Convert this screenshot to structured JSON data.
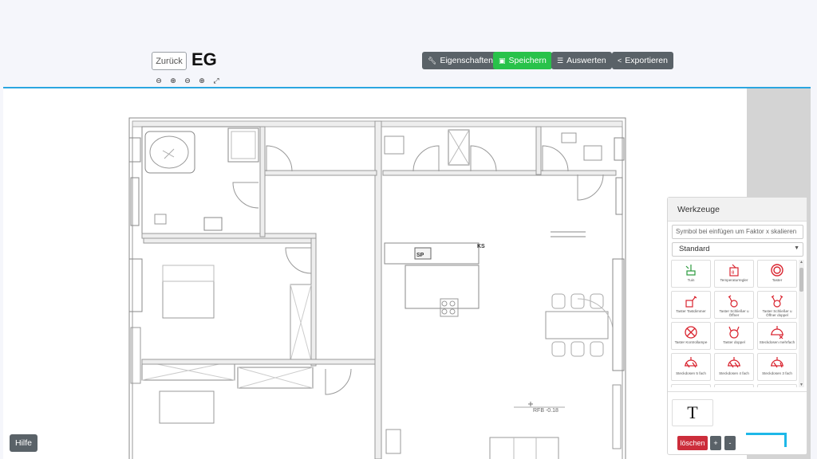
{
  "header": {
    "back_label": "Zurück",
    "title": "EG",
    "zoom_icons": [
      "zoom-out-icon",
      "zoom-in-icon",
      "zoom-reset-icon",
      "zoom-fit-icon",
      "fullscreen-icon"
    ]
  },
  "toolbar": {
    "properties_label": "Eigenschaften",
    "save_label": "Speichern",
    "evaluate_label": "Auswerten",
    "export_label": "Exportieren"
  },
  "plan": {
    "label_sp": "SP",
    "label_ks": "KS",
    "label_rfb": "RFB -0.18"
  },
  "tools": {
    "title": "Werkzeuge",
    "scale_placeholder": "Symbol bei einfügen um Faktor x skalieren",
    "category": "Standard",
    "symbols": [
      {
        "label": "Tuin",
        "icon": "door-opener-icon"
      },
      {
        "label": "Temperaturregler",
        "icon": "thermostat-icon"
      },
      {
        "label": "Taster",
        "icon": "button-circle-icon"
      },
      {
        "label": "Taster Tastdimmer",
        "icon": "dimmer-icon"
      },
      {
        "label": "Taster Schließer u Öffner",
        "icon": "switch-nc-no-icon"
      },
      {
        "label": "Taster Schließer u Öffner doppel",
        "icon": "switch-double-icon"
      },
      {
        "label": "Taster Kontrollampe",
        "icon": "control-lamp-icon"
      },
      {
        "label": "Taster doppel",
        "icon": "button-double-icon"
      },
      {
        "label": "Steckdosen mehrfach",
        "icon": "socket-multi-icon"
      },
      {
        "label": "Steckdosen 5 fach",
        "icon": "socket-5-icon"
      },
      {
        "label": "Steckdosen 4 fach",
        "icon": "socket-4-icon"
      },
      {
        "label": "Steckdosen 3 fach",
        "icon": "socket-3-icon"
      }
    ],
    "text_tool": "T",
    "delete_label": "löschen",
    "plus_label": "+",
    "minus_label": "-"
  },
  "help_label": "Hilfe",
  "colors": {
    "accent_line": "#2ba6e0",
    "save_green": "#28c24a",
    "button_gray": "#5a6268",
    "delete_red": "#cc2d3b",
    "symbol_red": "#d9232e"
  }
}
